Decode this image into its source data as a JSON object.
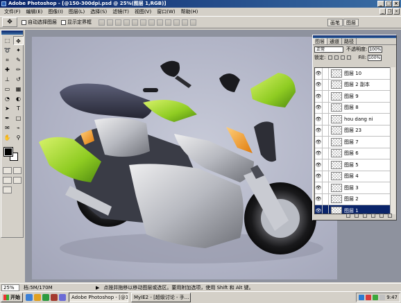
{
  "window": {
    "title": "Adobe Photoshop - [@150-300dpi.psd @ 25%(图层 1,RGB)]"
  },
  "menu": [
    "文件(F)",
    "编辑(E)",
    "图像(I)",
    "图层(L)",
    "选择(S)",
    "滤镜(T)",
    "视图(V)",
    "窗口(W)",
    "帮助(H)"
  ],
  "options": {
    "auto_select": "自动选择图层",
    "show_bounds": "显示定界框",
    "palette_well": [
      "画笔",
      "图层"
    ]
  },
  "layers_panel": {
    "tabs": [
      "图层",
      "通道",
      "路径"
    ],
    "blend_mode": "正常",
    "opacity_label": "不透明度:",
    "opacity_value": "100%",
    "lock_label": "锁定:",
    "fill_label": "Fill:",
    "fill_value": "100%",
    "layers": [
      {
        "name": "图层 10"
      },
      {
        "name": "图层 2 副本"
      },
      {
        "name": "图层 9"
      },
      {
        "name": "图层 8"
      },
      {
        "name": "hou dang ni"
      },
      {
        "name": "图层 23"
      },
      {
        "name": "图层 7"
      },
      {
        "name": "图层 6"
      },
      {
        "name": "图层 5"
      },
      {
        "name": "图层 4"
      },
      {
        "name": "图层 3"
      },
      {
        "name": "图层 2"
      },
      {
        "name": "图层 1",
        "selected": true
      }
    ]
  },
  "status": {
    "zoom": "25%",
    "doc_size": "档:5M/170M",
    "hint": "点按并拖移以移动图层或选区。要用附加选项，使用 Shift 和 Alt 键。"
  },
  "taskbar": {
    "start_label": "开始",
    "tasks": [
      "Adobe Photoshop - [@15...",
      "MyIE2 - [超级讨论 - 手..."
    ],
    "clock": "9:47"
  },
  "colors": {
    "title_bar": "#0a246a",
    "accent_green": "#9bd62a",
    "accent_orange": "#f29a1c",
    "selected_layer": "#0a246a"
  }
}
